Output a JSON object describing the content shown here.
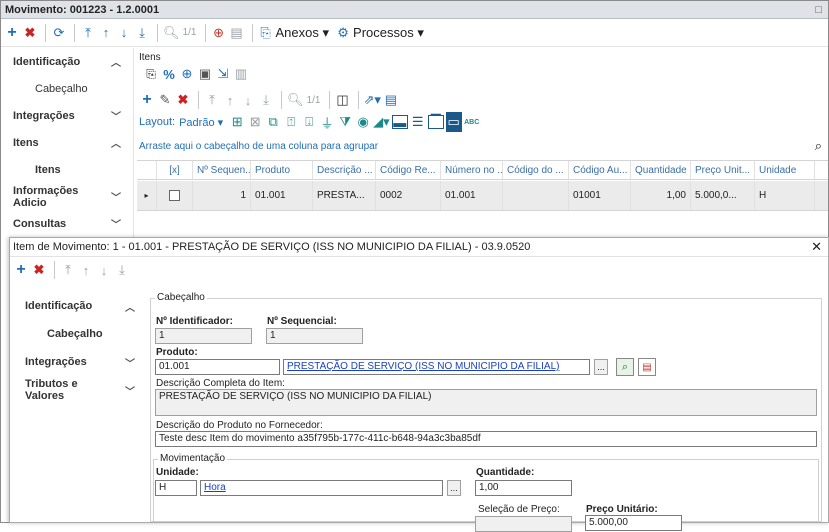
{
  "window": {
    "title": "Movimento: 001223 - 1.2.0001",
    "restore_icon": "□",
    "close_icon": "✕"
  },
  "toolbar": {
    "pager": "1/1",
    "anexos": "Anexos",
    "processos": "Processos"
  },
  "nav": {
    "identificacao": "Identificação",
    "cabecalho": "Cabeçalho",
    "integracoes": "Integrações",
    "itens": "Itens",
    "itens_sub": "Itens",
    "informacoes": "Informações Adicio",
    "consultas": "Consultas"
  },
  "itens_panel": {
    "title": "Itens",
    "pager": "1/1",
    "layout_label": "Layout:",
    "layout_value": "Padrão",
    "group_hint": "Arraste aqui o cabeçalho de uma coluna para agrupar",
    "columns": [
      "[x]",
      "Nº Sequen...",
      "Produto",
      "Descrição ...",
      "Código Re...",
      "Número no ...",
      "Código do ...",
      "Código Au...",
      "Quantidade",
      "Preço Unit...",
      "Unidade"
    ],
    "row": [
      "",
      "1",
      "01.001",
      "PRESTA...",
      "0002",
      "01.001",
      "",
      "01001",
      "1,00",
      "5.000,0...",
      "H"
    ]
  },
  "dialog": {
    "title": "Item de Movimento: 1 - 01.001 - PRESTAÇÃO DE SERVIÇO (ISS NO MUNICIPIO DA FILIAL) - 03.9.0520",
    "nav": {
      "identificacao": "Identificação",
      "cabecalho": "Cabeçalho",
      "integracoes": "Integrações",
      "tributos": "Tributos e Valores"
    },
    "cabecalho_group": "Cabeçalho",
    "nid_label": "Nº Identificador:",
    "nid_value": "1",
    "nseq_label": "Nº Sequencial:",
    "nseq_value": "1",
    "produto_label": "Produto:",
    "produto_code": "01.001",
    "produto_desc": "PRESTAÇÃO DE SERVIÇO (ISS NO MUNICIPIO DA FILIAL)",
    "desc_completa_label": "Descrição Completa do Item:",
    "desc_completa_value": "PRESTAÇÃO DE SERVIÇO (ISS NO MUNICIPIO DA FILIAL)",
    "desc_fornecedor_label": "Descrição do Produto no Fornecedor:",
    "desc_fornecedor_value": "Teste desc Item do movimento a35f795b-177c-411c-b648-94a3c3ba85df",
    "movimentacao_group": "Movimentação",
    "unidade_label": "Unidade:",
    "unidade_code": "H",
    "unidade_desc": "Hora",
    "quantidade_label": "Quantidade:",
    "quantidade_value": "1,00",
    "selecao_preco_label": "Seleção de Preço:",
    "preco_unit_label": "Preço Unitário:",
    "preco_unit_value": "5.000,00",
    "ellipsis": "..."
  }
}
